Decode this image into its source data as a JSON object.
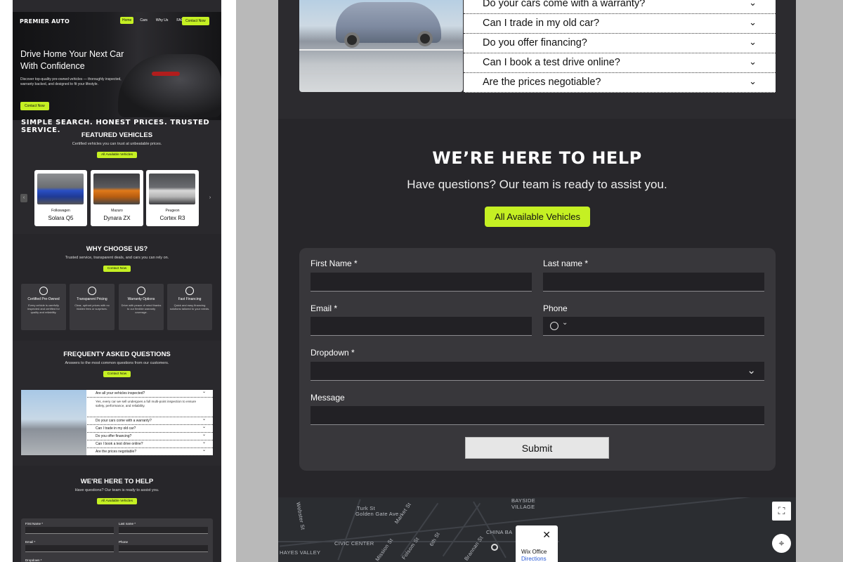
{
  "mini": {
    "logo": "PREMIER AUTO",
    "nav": [
      "Home",
      "Cars",
      "Why Us",
      "FAQ"
    ],
    "nav_button": "Contact Now",
    "hero_title": "Drive Home Your Next Car With Confidence",
    "hero_text": "Discover top-quality pre-owned vehicles — thoroughly inspected, warranty backed, and designed to fit your lifestyle.",
    "hero_cta": "Contact Now",
    "tagline": "SIMPLE SEARCH. HONEST PRICES. TRUSTED SERVICE.",
    "featured": {
      "title": "FEATURED VEHICLES",
      "subtitle": "Certified vehicles you can trust at unbeatable prices.",
      "button": "All Available Vehicles",
      "cars": [
        {
          "make": "Folkswagen",
          "model": "Solara Q5",
          "color": "#2a4fc4"
        },
        {
          "make": "Mazuro",
          "model": "Dynara ZX",
          "color": "#e07a1b"
        },
        {
          "make": "Peugeon",
          "model": "Cortex R3",
          "color": "#d8d8d8"
        }
      ]
    },
    "why": {
      "title": "WHY CHOOSE US?",
      "subtitle": "Trusted service, transparent deals, and cars you can rely on.",
      "button": "Contact Now",
      "cards": [
        {
          "title": "Certified Pre-Owned",
          "desc": "Every vehicle is carefully inspected and certified for quality and reliability."
        },
        {
          "title": "Transparent Pricing",
          "desc": "Clear, upfront prices with no hidden fees or surprises."
        },
        {
          "title": "Warranty Options",
          "desc": "Drive with peace of mind thanks to our flexible warranty coverage."
        },
        {
          "title": "Fast Financing",
          "desc": "Quick and easy financing solutions tailored to your needs."
        }
      ]
    },
    "faq": {
      "title": "FREQUENTY ASKED QUESTIONS",
      "subtitle": "Answers to the most common questions from our customers.",
      "button": "Contact Now",
      "open_question": "Are all your vehicles inspected?",
      "open_answer": "Yes, every car we sell undergoes a full multi-point inspection to ensure safety, performance, and reliability.",
      "questions": [
        "Do your cars come with a warranty?",
        "Can I trade in my old car?",
        "Do you offer financing?",
        "Can I book a test drive online?",
        "Are the prices negotiable?"
      ]
    },
    "help": {
      "title": "WE'RE HERE TO HELP",
      "subtitle": "Have questions? Our team is ready to assist you.",
      "button": "All Available Vehicles",
      "first": "First Name *",
      "last": "Last name *",
      "email": "Email *",
      "phone": "Phone",
      "dropdown": "Dropdown *"
    }
  },
  "main": {
    "faq_questions": [
      "Do your cars come with a warranty?",
      "Can I trade in my old car?",
      "Do you offer financing?",
      "Can I book a test drive online?",
      "Are the prices negotiable?"
    ],
    "help_title": "WE’RE HERE TO HELP",
    "help_subtitle": "Have questions? Our team is ready to assist you.",
    "help_button": "All Available Vehicles",
    "form": {
      "first_name": "First Name *",
      "last_name": "Last name *",
      "email": "Email *",
      "phone": "Phone",
      "dropdown": "Dropdown *",
      "message": "Message",
      "submit": "Submit"
    },
    "map": {
      "labels": [
        "Webster St",
        "Turk St",
        "Golden Gate Ave",
        "Market St",
        "BAYSIDE VILLAGE",
        "CIVIC CENTER",
        "CHINA BA",
        "HAYES VALLEY",
        "Mission St",
        "Brannan St",
        "6th St",
        "Folsom St"
      ],
      "popup_title": "Wix Office",
      "popup_link": "Directions"
    }
  },
  "colors": {
    "accent": "#c5f023",
    "panel": "#27262a",
    "form": "#38373b"
  }
}
